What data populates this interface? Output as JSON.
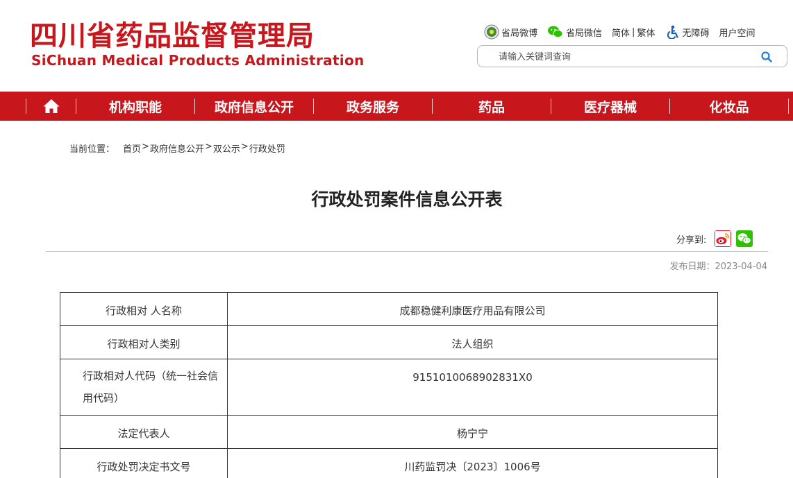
{
  "header": {
    "logo_cn": "四川省药品监督管理局",
    "logo_en": "SiChuan Medical Products Administration",
    "links": {
      "weibo": "省局微博",
      "wechat": "省局微信",
      "simplified": "简体",
      "divider": "|",
      "traditional": "繁体",
      "accessibility": "无障碍",
      "user_space": "用户空间"
    },
    "search": {
      "placeholder": "请输入关键词查询",
      "value": ""
    }
  },
  "nav": {
    "home_icon": "home-icon",
    "items": [
      {
        "label": "机构职能"
      },
      {
        "label": "政府信息公开"
      },
      {
        "label": "政务服务"
      },
      {
        "label": "药品"
      },
      {
        "label": "医疗器械"
      },
      {
        "label": "化妆品"
      }
    ]
  },
  "breadcrumb": {
    "label": "当前位置：",
    "items": [
      "首页",
      "政府信息公开",
      "双公示",
      "行政处罚"
    ],
    "separator": ">"
  },
  "article": {
    "title": "行政处罚案件信息公开表",
    "share_label": "分享到:",
    "publish_date": "发布日期：2023-04-04"
  },
  "table": {
    "rows": [
      {
        "key": "行政相对 人名称",
        "value": "成都稳健利康医疗用品有限公司"
      },
      {
        "key": "行政相对人类别",
        "value": "法人组织"
      },
      {
        "key": "行政相对人代码（统一社会信用代码）",
        "value": "9151010068902831X0"
      },
      {
        "key": "法定代表人",
        "value": "杨宁宁"
      },
      {
        "key": "行政处罚决定书文号",
        "value": "川药监罚决〔2023〕1006号"
      }
    ]
  },
  "colors": {
    "brand_red": "#c8161d",
    "weibo_red": "#e6162d",
    "wechat_green": "#2dc100"
  }
}
